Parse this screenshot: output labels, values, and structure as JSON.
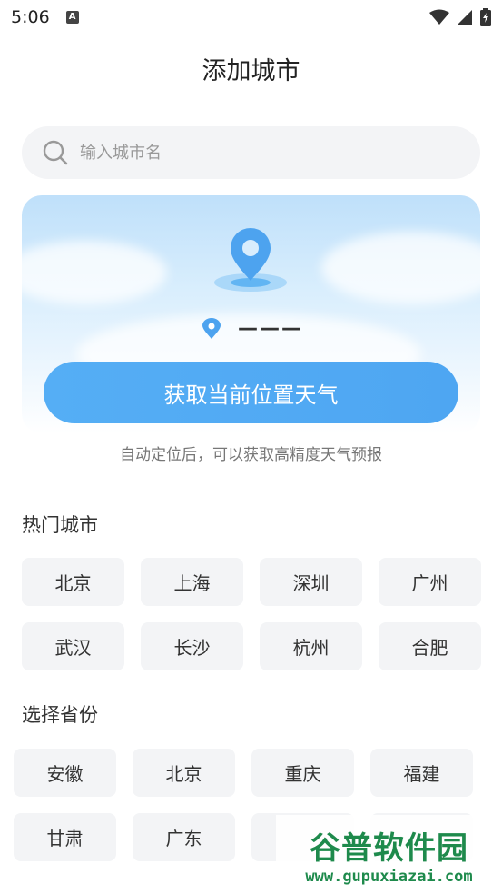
{
  "status_bar": {
    "time": "5:06",
    "notification_icon": "A"
  },
  "header": {
    "title": "添加城市"
  },
  "search": {
    "placeholder": "输入城市名"
  },
  "location": {
    "current_value": "———",
    "button_label": "获取当前位置天气",
    "hint": "自动定位后，可以获取高精度天气预报"
  },
  "hot_cities": {
    "title": "热门城市",
    "items": [
      "北京",
      "上海",
      "深圳",
      "广州",
      "武汉",
      "长沙",
      "杭州",
      "合肥"
    ]
  },
  "provinces": {
    "title": "选择省份",
    "items": [
      "安徽",
      "北京",
      "重庆",
      "福建",
      "甘肃",
      "广东",
      "",
      ""
    ]
  },
  "watermark": {
    "brand": "谷普软件园",
    "url": "www.gupuxiazai.com"
  },
  "colors": {
    "accent": "#4ea6f2",
    "chip_bg": "#f3f4f6"
  }
}
